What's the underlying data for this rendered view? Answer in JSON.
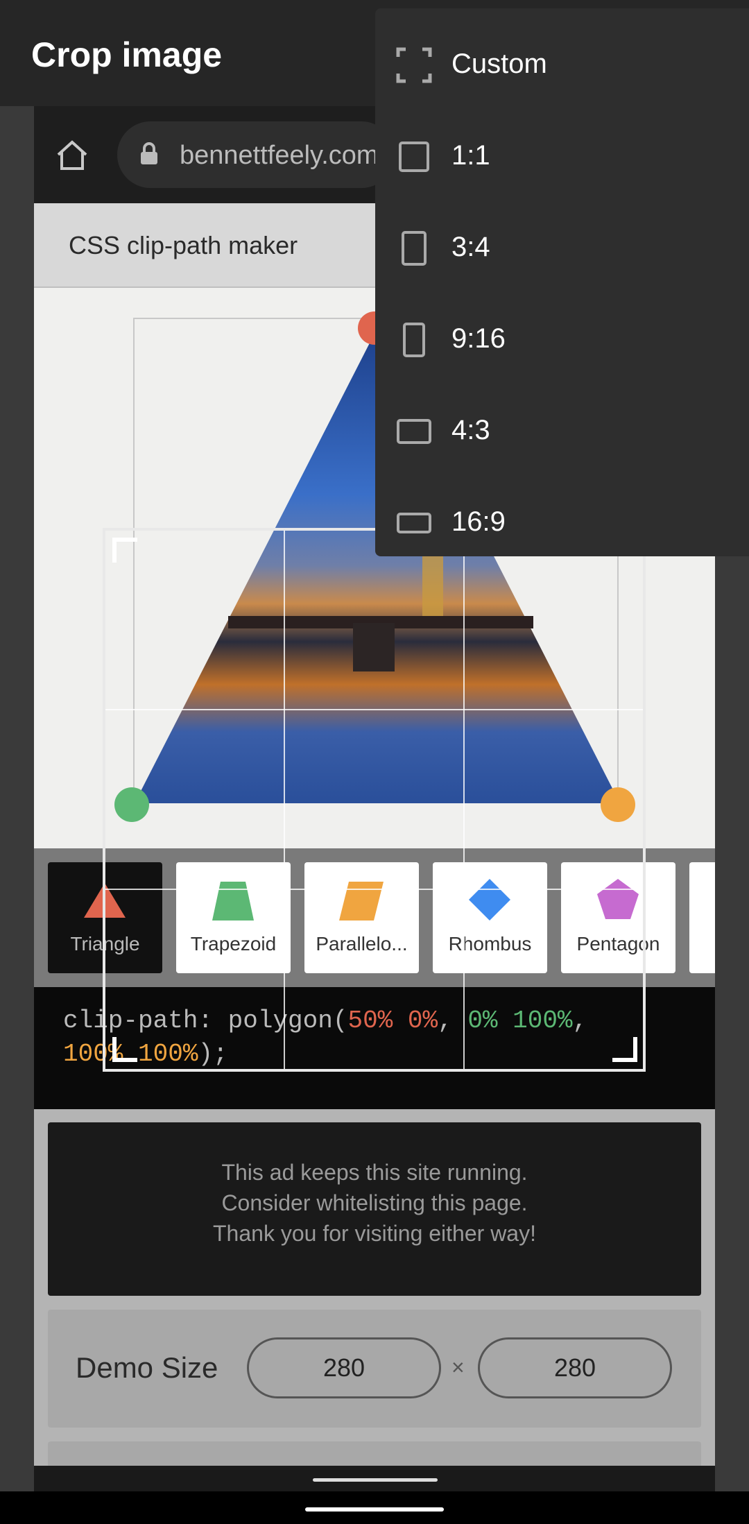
{
  "app": {
    "title": "Crop image"
  },
  "aspect_menu": {
    "items": [
      {
        "label": "Custom",
        "icon": "free-crop-icon"
      },
      {
        "label": "1:1",
        "icon": "square-ratio-icon"
      },
      {
        "label": "3:4",
        "icon": "portrait-ratio-icon"
      },
      {
        "label": "9:16",
        "icon": "tall-portrait-ratio-icon"
      },
      {
        "label": "4:3",
        "icon": "landscape-ratio-icon"
      },
      {
        "label": "16:9",
        "icon": "wide-landscape-ratio-icon"
      }
    ]
  },
  "screenshot": {
    "url": "bennettfeely.com",
    "site_title": "CSS clip-path maker",
    "shapes": [
      "Triangle",
      "Trapezoid",
      "Parallelo...",
      "Rhombus",
      "Pentagon"
    ],
    "code": {
      "prefix": "clip-path: polygon(",
      "p1": "50% 0%",
      "sep1": ", ",
      "p2": "0% 100%",
      "sep2": ",",
      "p3": "100% 100%",
      "suffix": ");"
    },
    "ad_lines": [
      "This ad keeps this site running.",
      "Consider whitelisting this page.",
      "Thank you for visiting either way!"
    ],
    "demo_size": {
      "label": "Demo Size",
      "width": "280",
      "times": "×",
      "height": "280"
    }
  },
  "colors": {
    "point_red": "#e0654e",
    "point_green": "#5cb874",
    "point_orange": "#f0a540",
    "rhombus_blue": "#3f8cf0",
    "pentagon_purple": "#c66bd0"
  }
}
